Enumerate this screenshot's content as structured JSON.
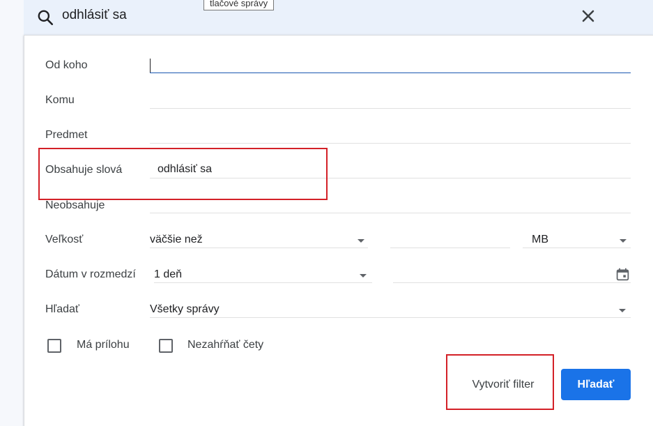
{
  "search": {
    "query": "odhlásiť sa",
    "tooltip": "tlačové správy"
  },
  "form": {
    "from": {
      "label": "Od koho",
      "value": ""
    },
    "to": {
      "label": "Komu",
      "value": ""
    },
    "subject": {
      "label": "Predmet",
      "value": ""
    },
    "has_words": {
      "label": "Obsahuje slová",
      "value": "odhlásiť sa"
    },
    "doesnt_have": {
      "label": "Neobsahuje",
      "value": ""
    },
    "size": {
      "label": "Veľkosť",
      "operator": "väčšie než",
      "value": "",
      "unit": "MB"
    },
    "date_within": {
      "label": "Dátum v rozmedzí",
      "range": "1 deň",
      "date": ""
    },
    "search_in": {
      "label": "Hľadať",
      "value": "Všetky správy"
    },
    "has_attachment": {
      "label": "Má prílohu",
      "checked": false
    },
    "exclude_chats": {
      "label": "Nezahŕňať čety",
      "checked": false
    }
  },
  "buttons": {
    "create_filter": "Vytvoriť filter",
    "search": "Hľadať"
  },
  "colors": {
    "accent": "#1a73e8",
    "highlight": "#d32027",
    "search_bar": "#eaf1fb"
  }
}
